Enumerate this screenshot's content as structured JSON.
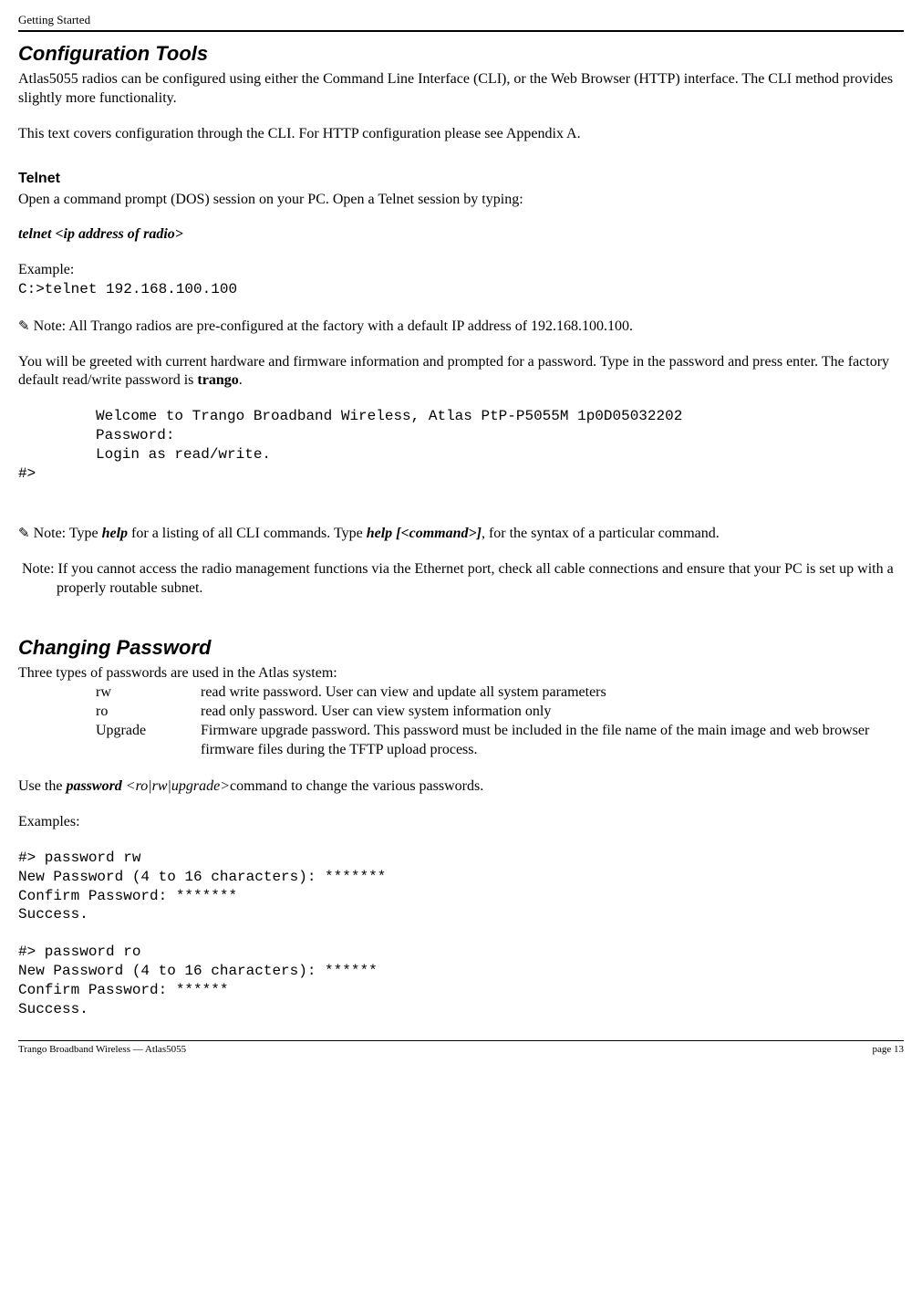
{
  "header": "Getting Started",
  "config_tools": {
    "heading": "Configuration Tools",
    "p1": "Atlas5055 radios can be configured using either the Command Line Interface (CLI), or the Web Browser (HTTP) interface.  The CLI method provides slightly more functionality.",
    "p2": "This text covers configuration through the CLI.  For HTTP configuration please see Appendix A."
  },
  "telnet": {
    "heading": "Telnet",
    "open_prompt": "Open a command prompt (DOS) session on your PC.  Open a Telnet session by typing:",
    "command_syntax": "telnet <ip address of radio>",
    "example_label": "Example:",
    "example_cmd": "C:>telnet 192.168.100.100",
    "note1_prefix": "  Note:  ",
    "note1_text": "All Trango radios are pre-configured at the factory with a default IP address of 192.168.100.100.",
    "greeting_para_a": "You will be greeted with current hardware and firmware information and prompted for a password.  Type in the password and press enter.  The factory default read/write password is ",
    "greeting_bold": "trango",
    "greeting_para_b": ".",
    "welcome_line": "Welcome to Trango Broadband Wireless, Atlas PtP-P5055M 1p0D05032202",
    "password_line": "Password:",
    "login_line": "Login as read/write.",
    "prompt_line": "#>",
    "note2_a": "  Note:  Type ",
    "note2_b": "help",
    "note2_c": " for a listing of all CLI commands.  Type ",
    "note2_d": "help [<command>]",
    "note2_e": ", for the syntax of a particular command.",
    "note3_a": "  Note:  If you cannot access the radio management functions via the Ethernet port, check all cable connections and ensure that your PC is set up with a properly routable subnet."
  },
  "changing_pw": {
    "heading": "Changing Password",
    "intro": "Three types of passwords are used in the Atlas system:",
    "rows": [
      {
        "key": "rw",
        "desc": "read write password.   User can view and update all system parameters"
      },
      {
        "key": "ro",
        "desc": "read only password.  User can view system information only"
      },
      {
        "key": "Upgrade",
        "desc": "Firmware upgrade password.  This password must be included in the file name of the main image and web browser firmware files during the TFTP upload process."
      }
    ],
    "use_a": "Use the ",
    "use_b": "password ",
    "use_c": "<ro|rw|upgrade>",
    "use_d": "command to change the various passwords.",
    "examples_label": "Examples:",
    "ex1": "#> password rw\nNew Password (4 to 16 characters): *******\nConfirm Password: *******\nSuccess.",
    "ex2": "#> password ro\nNew Password (4 to 16 characters): ******\nConfirm Password: ******\nSuccess."
  },
  "footer": {
    "left": "Trango Broadband Wireless — Atlas5055",
    "right": "page 13"
  },
  "icons": {
    "pencil": "✎"
  }
}
